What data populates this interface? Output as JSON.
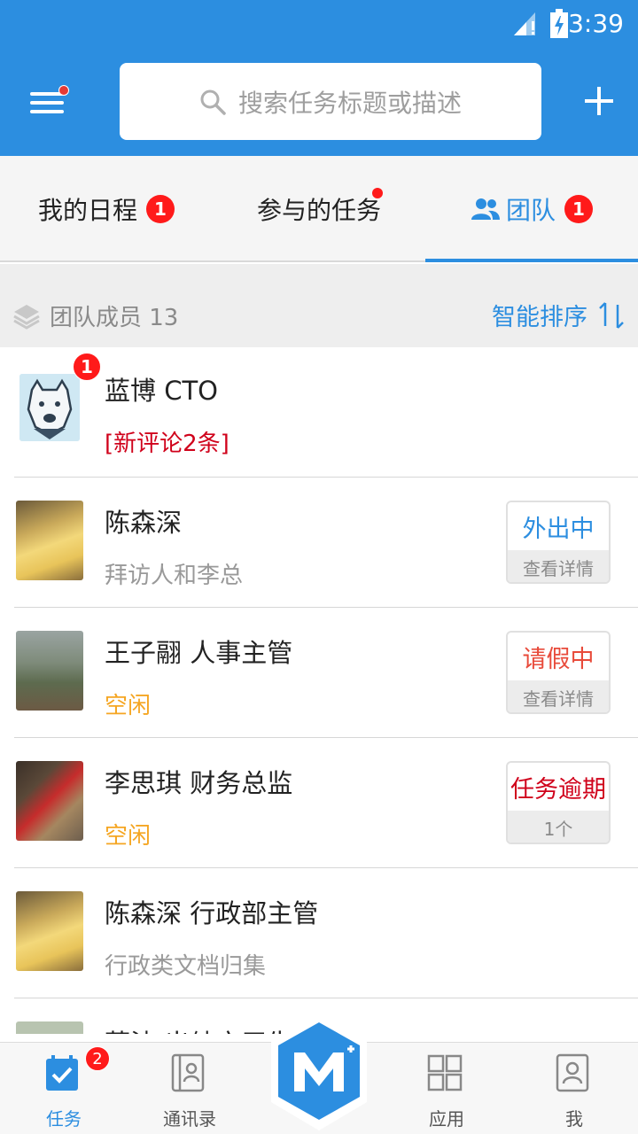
{
  "status_bar": {
    "time": "3:39"
  },
  "search": {
    "placeholder": "搜索任务标题或描述"
  },
  "tabs": [
    {
      "label": "我的日程",
      "badge": "1"
    },
    {
      "label": "参与的任务"
    },
    {
      "label": "团队",
      "badge": "1"
    }
  ],
  "section": {
    "label": "团队成员 13",
    "sort_label": "智能排序"
  },
  "members": [
    {
      "name": "蓝博 CTO",
      "sub": "[新评论2条]",
      "avatar_badge": "1"
    },
    {
      "name": "陈森深",
      "sub": "拜访人和李总",
      "status": "外出中",
      "status_detail": "查看详情"
    },
    {
      "name": "王子翮 人事主管",
      "sub": "空闲",
      "status": "请假中",
      "status_detail": "查看详情"
    },
    {
      "name": "李思琪 财务总监",
      "sub": "空闲",
      "status": "任务逾期",
      "status_detail": "1个"
    },
    {
      "name": "陈森深 行政部主管",
      "sub": "行政类文档归集"
    },
    {
      "name": "蓝波 出纳实习生"
    }
  ],
  "bottom_nav": {
    "tasks": "任务",
    "tasks_badge": "2",
    "contacts": "通讯录",
    "apps": "应用",
    "me": "我"
  },
  "colors": {
    "primary": "#2c8ee0",
    "badge": "#ff1a1a",
    "idle": "#f5a623",
    "alert": "#d0021b"
  }
}
